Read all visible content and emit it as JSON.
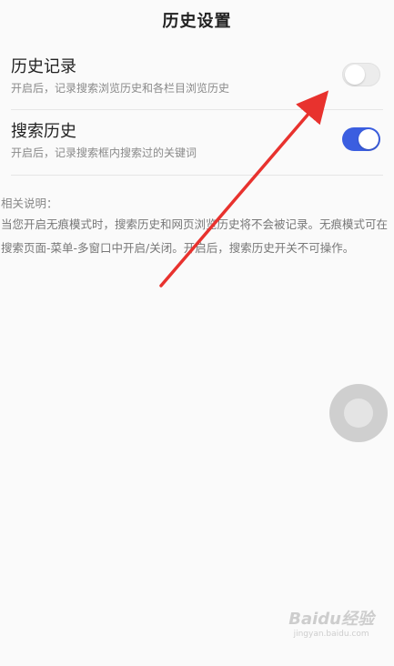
{
  "header": {
    "title": "历史设置"
  },
  "settings": [
    {
      "label": "历史记录",
      "description": "开启后，记录搜索浏览历史和各栏目浏览历史",
      "enabled": false
    },
    {
      "label": "搜索历史",
      "description": "开启后，记录搜索框内搜索过的关键词",
      "enabled": true
    }
  ],
  "notes": {
    "heading": "相关说明：",
    "body": "当您开启无痕模式时，搜索历史和网页浏览历史将不会被记录。无痕模式可在搜索页面-菜单-多窗口中开启/关闭。开启后，搜索历史开关不可操作。"
  },
  "watermark": {
    "logo": "Baidu经验",
    "url": "jingyan.baidu.com"
  },
  "colors": {
    "toggle_on": "#3b5ee0",
    "toggle_off": "#ececec",
    "annotation_arrow": "#e8322e"
  },
  "icons": {
    "assistive_touch": "assistive-touch-icon"
  }
}
